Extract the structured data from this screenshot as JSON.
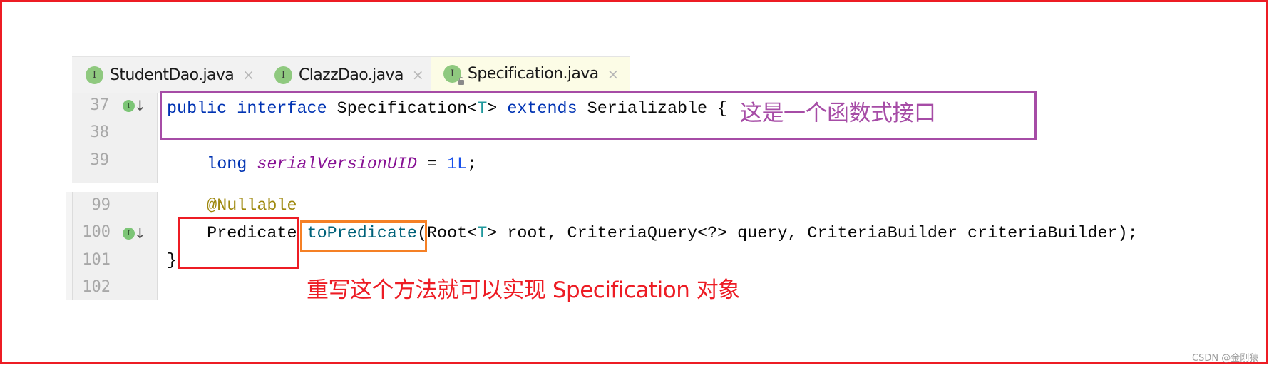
{
  "editor": {
    "tabs": [
      {
        "label": "StudentDao.java",
        "icon": "interface-icon",
        "icon_glyph": "I",
        "close_glyph": "×",
        "active": false
      },
      {
        "label": "ClazzDao.java",
        "icon": "interface-icon",
        "icon_glyph": "I",
        "close_glyph": "×",
        "active": false
      },
      {
        "label": "Specification.java",
        "icon": "interface-locked-icon",
        "icon_glyph": "I",
        "close_glyph": "×",
        "active": true
      }
    ],
    "gutter_icon_glyph": "I",
    "gutter_arrow_glyph": "↓",
    "snippet1": {
      "lines": [
        {
          "number": "37",
          "has_impl_icon": true
        },
        {
          "number": "38",
          "has_impl_icon": false
        },
        {
          "number": "39",
          "has_impl_icon": false
        }
      ],
      "code": {
        "l37": {
          "kw1": "public",
          "kw2": "interface",
          "name": "Specification",
          "lt": "<",
          "tparam": "T",
          "gt": ">",
          "kw3": "extends",
          "super": "Serializable",
          "brace": "{"
        },
        "l39": {
          "indent": "    ",
          "type": "long",
          "field": "serialVersionUID",
          "eq": " = ",
          "value": "1L",
          "semi": ";"
        }
      }
    },
    "snippet2": {
      "lines": [
        {
          "number": "99",
          "has_impl_icon": false
        },
        {
          "number": "100",
          "has_impl_icon": true
        },
        {
          "number": "101",
          "has_impl_icon": false
        },
        {
          "number": "102",
          "has_impl_icon": false
        }
      ],
      "code": {
        "l99": {
          "indent": "    ",
          "annotation": "@Nullable"
        },
        "l100": {
          "indent": "    ",
          "return_type": "Predicate",
          "method": "toPredicate",
          "open": "(",
          "p1_type": "Root",
          "lt": "<",
          "tparam": "T",
          "gt": ">",
          "rest": " root, CriteriaQuery<?> query, CriteriaBuilder criteriaBuilder);"
        },
        "l101": {
          "brace": "}"
        }
      }
    }
  },
  "annotations": {
    "functional_interface_note": "这是一个函数式接口",
    "override_note": "重写这个方法就可以实现 Specification 对象",
    "colors": {
      "purple": "#a64ca6",
      "red": "#ed1c24",
      "orange": "#f58025"
    }
  },
  "watermark": "CSDN @金刚猿"
}
